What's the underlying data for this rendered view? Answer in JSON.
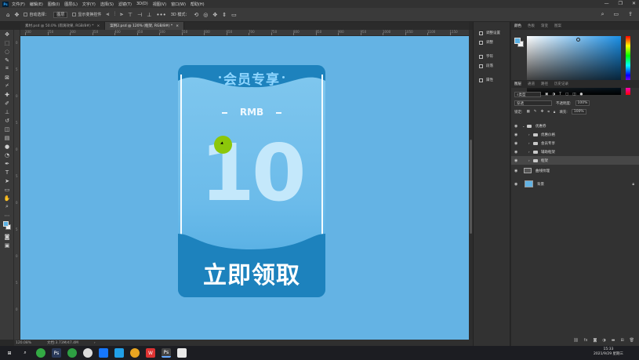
{
  "menubar": {
    "logo": "Ps",
    "items": [
      "文件(F)",
      "编辑(E)",
      "图像(I)",
      "图层(L)",
      "文字(Y)",
      "选择(S)",
      "滤镜(T)",
      "3D(D)",
      "视图(V)",
      "窗口(W)",
      "帮助(H)"
    ],
    "window_controls": [
      "—",
      "❐",
      "✕"
    ]
  },
  "options": {
    "auto_select_label": "自动选择：",
    "auto_select_value": "图层",
    "show_transform_label": "显示变换控件",
    "more": "•••",
    "mode_label": "3D 模式："
  },
  "tabs": [
    {
      "label": "素材.psd @ 50.0% (雨滴效果, RGB/8#) *",
      "close": "×"
    },
    {
      "label": "案例2.psd @ 120% (框架, RGB/8#) *",
      "close": "×"
    }
  ],
  "rulers": {
    "top": [
      "200",
      "250",
      "300",
      "350",
      "400",
      "450",
      "500",
      "550",
      "600",
      "650",
      "700",
      "750",
      "800",
      "850",
      "900",
      "950",
      "1000",
      "1050",
      "1100",
      "1150"
    ],
    "left": [
      "0",
      "5",
      "0",
      "5",
      "0",
      "5",
      "0",
      "5",
      "0",
      "5",
      "0"
    ]
  },
  "canvas": {
    "coupon": {
      "title": "会员专享",
      "currency": "RMB",
      "amount": "10",
      "button": "立即领取"
    }
  },
  "status": {
    "zoom": "120.08%",
    "doc": "文档:3.73M/47.4M",
    "arrow": "›"
  },
  "mini_panel": [
    {
      "label": "调整设置"
    },
    {
      "label": "调整"
    },
    {
      "label": "字符"
    },
    {
      "label": "段落"
    },
    {
      "label": "属性"
    }
  ],
  "color_panel": {
    "tabs": [
      "颜色",
      "色板",
      "渐变",
      "图案"
    ]
  },
  "layers_panel": {
    "tabs": [
      "图层",
      "通道",
      "路径",
      "历史记录"
    ],
    "kind_label": "类型",
    "blend_mode": "穿透",
    "opacity_label": "不透明度:",
    "opacity_value": "100%",
    "lock_label": "锁定:",
    "fill_label": "填充:",
    "fill_value": "100%",
    "layers": [
      {
        "name": "优惠券",
        "type": "group",
        "expanded": true,
        "selected": false
      },
      {
        "name": "优惠价格",
        "type": "group",
        "expanded": false,
        "selected": false
      },
      {
        "name": "会员专享",
        "type": "group",
        "expanded": false,
        "selected": false
      },
      {
        "name": "辅助框架",
        "type": "group",
        "expanded": false,
        "selected": false
      },
      {
        "name": "框架",
        "type": "group",
        "expanded": false,
        "selected": true
      },
      {
        "name": "曲线纹理",
        "type": "layer",
        "selected": false
      },
      {
        "name": "背景",
        "type": "background",
        "selected": false
      }
    ]
  },
  "clock": {
    "time": "15:33",
    "date": "2021/9/29 星期三"
  },
  "colors": {
    "canvas_bg": "#64b3e4",
    "coupon_dark": "#1d82bd",
    "accent": "#8cc70a"
  }
}
